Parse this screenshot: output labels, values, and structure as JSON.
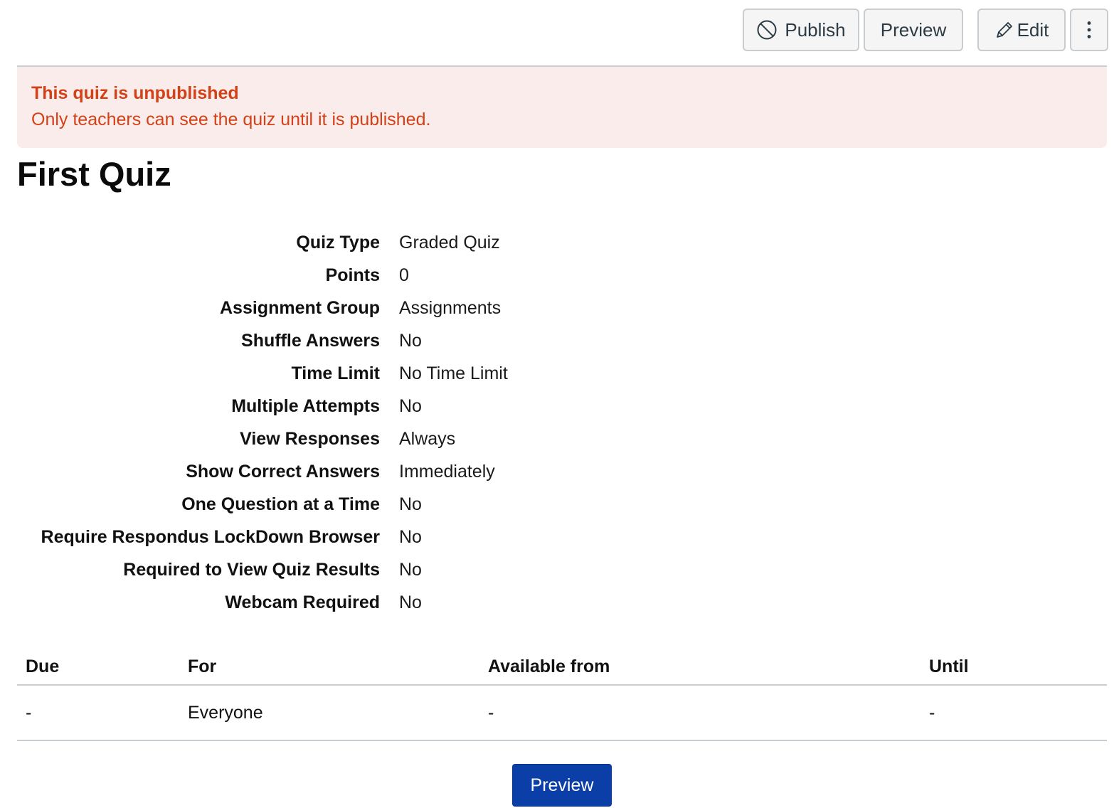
{
  "toolbar": {
    "publish_label": "Publish",
    "preview_label": "Preview",
    "edit_label": "Edit"
  },
  "alert": {
    "title": "This quiz is unpublished",
    "message": "Only teachers can see the quiz until it is published."
  },
  "quiz": {
    "title": "First Quiz"
  },
  "details": [
    {
      "label": "Quiz Type",
      "value": "Graded Quiz"
    },
    {
      "label": "Points",
      "value": "0"
    },
    {
      "label": "Assignment Group",
      "value": "Assignments"
    },
    {
      "label": "Shuffle Answers",
      "value": "No"
    },
    {
      "label": "Time Limit",
      "value": "No Time Limit"
    },
    {
      "label": "Multiple Attempts",
      "value": "No"
    },
    {
      "label": "View Responses",
      "value": "Always"
    },
    {
      "label": "Show Correct Answers",
      "value": "Immediately"
    },
    {
      "label": "One Question at a Time",
      "value": "No"
    },
    {
      "label": "Require Respondus LockDown Browser",
      "value": "No"
    },
    {
      "label": "Required to View Quiz Results",
      "value": "No"
    },
    {
      "label": "Webcam Required",
      "value": "No"
    }
  ],
  "dates_table": {
    "headers": {
      "due": "Due",
      "for": "For",
      "available_from": "Available from",
      "until": "Until"
    },
    "rows": [
      {
        "due": "-",
        "for": "Everyone",
        "available_from": "-",
        "until": "-"
      }
    ]
  },
  "footer": {
    "preview_label": "Preview"
  },
  "icons": {
    "publish": "no-entry-circle-icon",
    "edit": "pencil-icon",
    "more": "kebab-menu-icon"
  },
  "colors": {
    "alert_bg": "#faecea",
    "alert_text": "#d24117",
    "primary_button": "#0b3fa7",
    "border": "#c7cdd1"
  }
}
